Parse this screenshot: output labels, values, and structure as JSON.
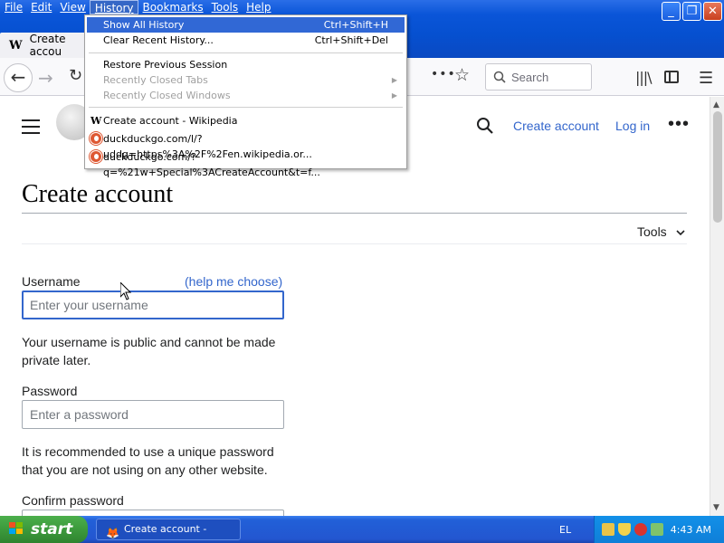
{
  "menubar": {
    "items": [
      "File",
      "Edit",
      "View",
      "History",
      "Bookmarks",
      "Tools",
      "Help"
    ],
    "active": "History"
  },
  "window_controls": {
    "minimize": "_",
    "maximize": "❐",
    "close": "✕"
  },
  "tab": {
    "icon": "W",
    "title": "Create accou"
  },
  "toolbar": {
    "search_placeholder": "Search",
    "icons": [
      "back-arrow-icon",
      "forward-arrow-icon",
      "reload-icon",
      "page-actions-icon",
      "bookmark-star-icon",
      "search-icon",
      "library-icon",
      "sidebar-icon",
      "menu-icon"
    ]
  },
  "history_menu": {
    "show_all": {
      "label": "Show All History",
      "shortcut": "Ctrl+Shift+H"
    },
    "clear_recent": {
      "label": "Clear Recent History...",
      "shortcut": "Ctrl+Shift+Del"
    },
    "restore_session": "Restore Previous Session",
    "recently_closed_tabs": "Recently Closed Tabs",
    "recently_closed_windows": "Recently Closed Windows",
    "entries": [
      "Create account - Wikipedia",
      "duckduckgo.com/l/?uddg=https%3A%2F%2Fen.wikipedia.or...",
      "duckduckgo.com/?q=%21w+Special%3ACreateAccount&t=f..."
    ]
  },
  "wiki_header": {
    "create_account": "Create account",
    "log_in": "Log in",
    "more": "•••"
  },
  "page": {
    "title": "Create account",
    "tools": "Tools",
    "username_label": "Username",
    "help_me_choose": "(help me choose)",
    "username_placeholder": "Enter your username",
    "username_help": "Your username is public and cannot be made private later.",
    "password_label": "Password",
    "password_placeholder": "Enter a password",
    "password_help": "It is recommended to use a unique password that you are not using on any other website.",
    "confirm_label": "Confirm password"
  },
  "taskbar": {
    "start": "start",
    "task_title": "Create account - Wiki...",
    "language": "EL",
    "clock": "4:43 AM"
  },
  "colors": {
    "link": "#3366cc",
    "menu_highlight": "#3168d5",
    "xp_blue": "#0a55d8",
    "start_green": "#3c9a3c"
  }
}
